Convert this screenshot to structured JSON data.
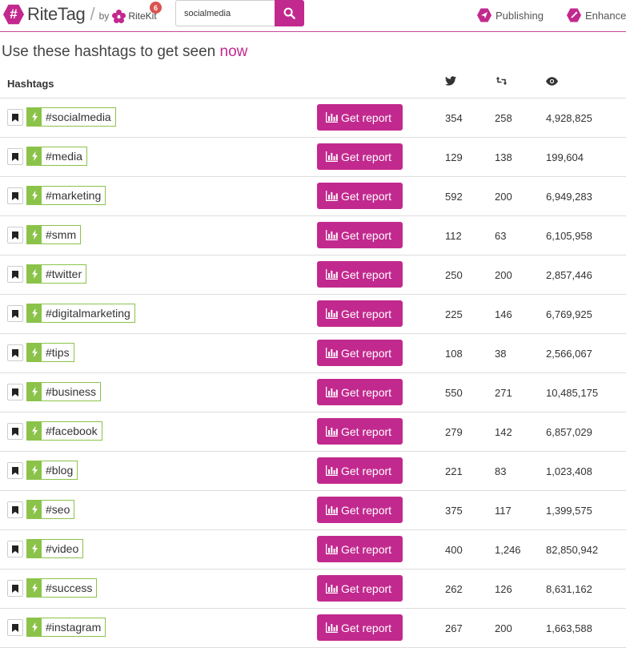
{
  "header": {
    "logo_symbol": "#",
    "logo_text": "RiteTag",
    "by_label": "by",
    "ritekit_label": "RiteKit",
    "badge_count": "6",
    "search_value": "socialmedia",
    "nav": [
      {
        "label": "Publishing",
        "icon": "send-icon"
      },
      {
        "label": "Enhance",
        "icon": "wand-icon"
      }
    ]
  },
  "page": {
    "title": "Use these hashtags to get seen",
    "title_accent": "now",
    "hashtags_header": "Hashtags",
    "report_label": "Get report"
  },
  "colors": {
    "accent": "#c2298e",
    "tag_green": "#8bc34a",
    "badge_red": "#d9534f"
  },
  "rows": [
    {
      "tag": "#socialmedia",
      "tweets": "354",
      "retweets": "258",
      "views": "4,928,825"
    },
    {
      "tag": "#media",
      "tweets": "129",
      "retweets": "138",
      "views": "199,604"
    },
    {
      "tag": "#marketing",
      "tweets": "592",
      "retweets": "200",
      "views": "6,949,283"
    },
    {
      "tag": "#smm",
      "tweets": "112",
      "retweets": "63",
      "views": "6,105,958"
    },
    {
      "tag": "#twitter",
      "tweets": "250",
      "retweets": "200",
      "views": "2,857,446"
    },
    {
      "tag": "#digitalmarketing",
      "tweets": "225",
      "retweets": "146",
      "views": "6,769,925"
    },
    {
      "tag": "#tips",
      "tweets": "108",
      "retweets": "38",
      "views": "2,566,067"
    },
    {
      "tag": "#business",
      "tweets": "550",
      "retweets": "271",
      "views": "10,485,175"
    },
    {
      "tag": "#facebook",
      "tweets": "279",
      "retweets": "142",
      "views": "6,857,029"
    },
    {
      "tag": "#blog",
      "tweets": "221",
      "retweets": "83",
      "views": "1,023,408"
    },
    {
      "tag": "#seo",
      "tweets": "375",
      "retweets": "117",
      "views": "1,399,575"
    },
    {
      "tag": "#video",
      "tweets": "400",
      "retweets": "1,246",
      "views": "82,850,942"
    },
    {
      "tag": "#success",
      "tweets": "262",
      "retweets": "126",
      "views": "8,631,162"
    },
    {
      "tag": "#instagram",
      "tweets": "267",
      "retweets": "200",
      "views": "1,663,588"
    }
  ]
}
